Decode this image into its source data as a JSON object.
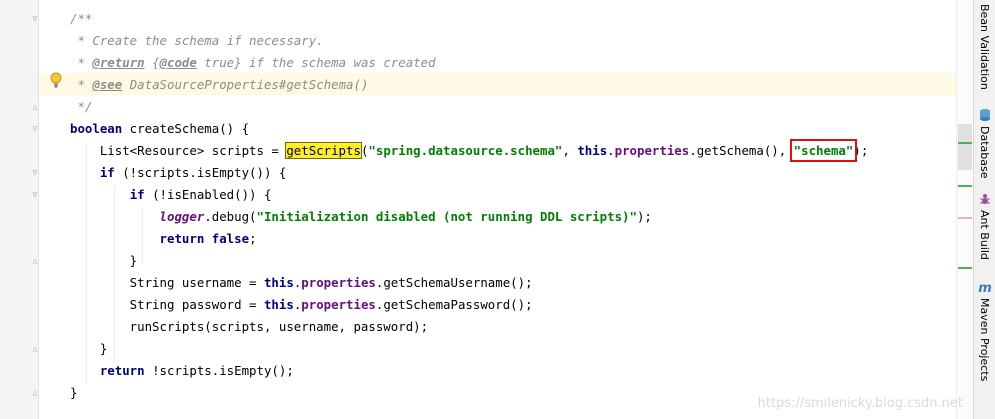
{
  "editor": {
    "lines": [
      [
        {
          "t": "/**",
          "c": "cmt"
        }
      ],
      [
        {
          "t": " * Create the schema if necessary.",
          "c": "cmt"
        }
      ],
      [
        {
          "t": " * ",
          "c": "cmt"
        },
        {
          "t": "@return",
          "c": "tag"
        },
        {
          "t": " {",
          "c": "cmt"
        },
        {
          "t": "@code",
          "c": "tag"
        },
        {
          "t": " true} if the schema was created",
          "c": "cmt"
        }
      ],
      [
        {
          "t": " * ",
          "c": "cmt"
        },
        {
          "t": "@see",
          "c": "tag"
        },
        {
          "t": " DataSourceProperties#getSchema()",
          "c": "cmt"
        }
      ],
      [
        {
          "t": " */",
          "c": "cmt"
        }
      ],
      [
        {
          "t": "boolean",
          "c": "kw"
        },
        {
          "t": " createSchema() {",
          "c": ""
        }
      ],
      [
        {
          "t": "    List<Resource> scripts = ",
          "c": ""
        },
        {
          "t": "getScripts",
          "c": "hlm"
        },
        {
          "t": "(",
          "c": ""
        },
        {
          "t": "\"spring.datasource.schema\"",
          "c": "str"
        },
        {
          "t": ", ",
          "c": ""
        },
        {
          "t": "this",
          "c": "kw"
        },
        {
          "t": ".",
          "c": ""
        },
        {
          "t": "properties",
          "c": "fld"
        },
        {
          "t": ".getSchema(), ",
          "c": ""
        },
        {
          "t": "\"schema\"",
          "c": "str boxm"
        },
        {
          "t": ");",
          "c": ""
        }
      ],
      [
        {
          "t": "    ",
          "c": ""
        },
        {
          "t": "if",
          "c": "kw"
        },
        {
          "t": " (!scripts.isEmpty()) {",
          "c": ""
        }
      ],
      [
        {
          "t": "        ",
          "c": ""
        },
        {
          "t": "if",
          "c": "kw"
        },
        {
          "t": " (!isEnabled()) {",
          "c": ""
        }
      ],
      [
        {
          "t": "            ",
          "c": ""
        },
        {
          "t": "logger",
          "c": "slog"
        },
        {
          "t": ".debug(",
          "c": ""
        },
        {
          "t": "\"Initialization disabled (not running DDL scripts)\"",
          "c": "str"
        },
        {
          "t": ");",
          "c": ""
        }
      ],
      [
        {
          "t": "            ",
          "c": ""
        },
        {
          "t": "return false",
          "c": "kw"
        },
        {
          "t": ";",
          "c": ""
        }
      ],
      [
        {
          "t": "        }",
          "c": ""
        }
      ],
      [
        {
          "t": "        String username = ",
          "c": ""
        },
        {
          "t": "this",
          "c": "kw"
        },
        {
          "t": ".",
          "c": ""
        },
        {
          "t": "properties",
          "c": "fld"
        },
        {
          "t": ".getSchemaUsername();",
          "c": ""
        }
      ],
      [
        {
          "t": "        String password = ",
          "c": ""
        },
        {
          "t": "this",
          "c": "kw"
        },
        {
          "t": ".",
          "c": ""
        },
        {
          "t": "properties",
          "c": "fld"
        },
        {
          "t": ".getSchemaPassword();",
          "c": ""
        }
      ],
      [
        {
          "t": "        runScripts(scripts, username, password);",
          "c": ""
        }
      ],
      [
        {
          "t": "    }",
          "c": ""
        }
      ],
      [
        {
          "t": "    ",
          "c": ""
        },
        {
          "t": "return",
          "c": "kw"
        },
        {
          "t": " !scripts.isEmpty();",
          "c": ""
        }
      ],
      [
        {
          "t": "}",
          "c": ""
        }
      ]
    ]
  },
  "tool_windows": [
    {
      "label": "Bean Validation",
      "icon": "bean-validation-icon"
    },
    {
      "label": "Database",
      "icon": "database-icon"
    },
    {
      "label": "Ant Build",
      "icon": "ant-icon"
    },
    {
      "label": "Maven Projects",
      "icon": "maven-icon"
    }
  ],
  "colors": {
    "keyword": "#000080",
    "string": "#008000",
    "field": "#660e7a",
    "comment": "#8c8c8c",
    "highlight": "#ffef28",
    "box": "#e01010"
  },
  "watermark": "https://smilenicky.blog.csdn.net"
}
